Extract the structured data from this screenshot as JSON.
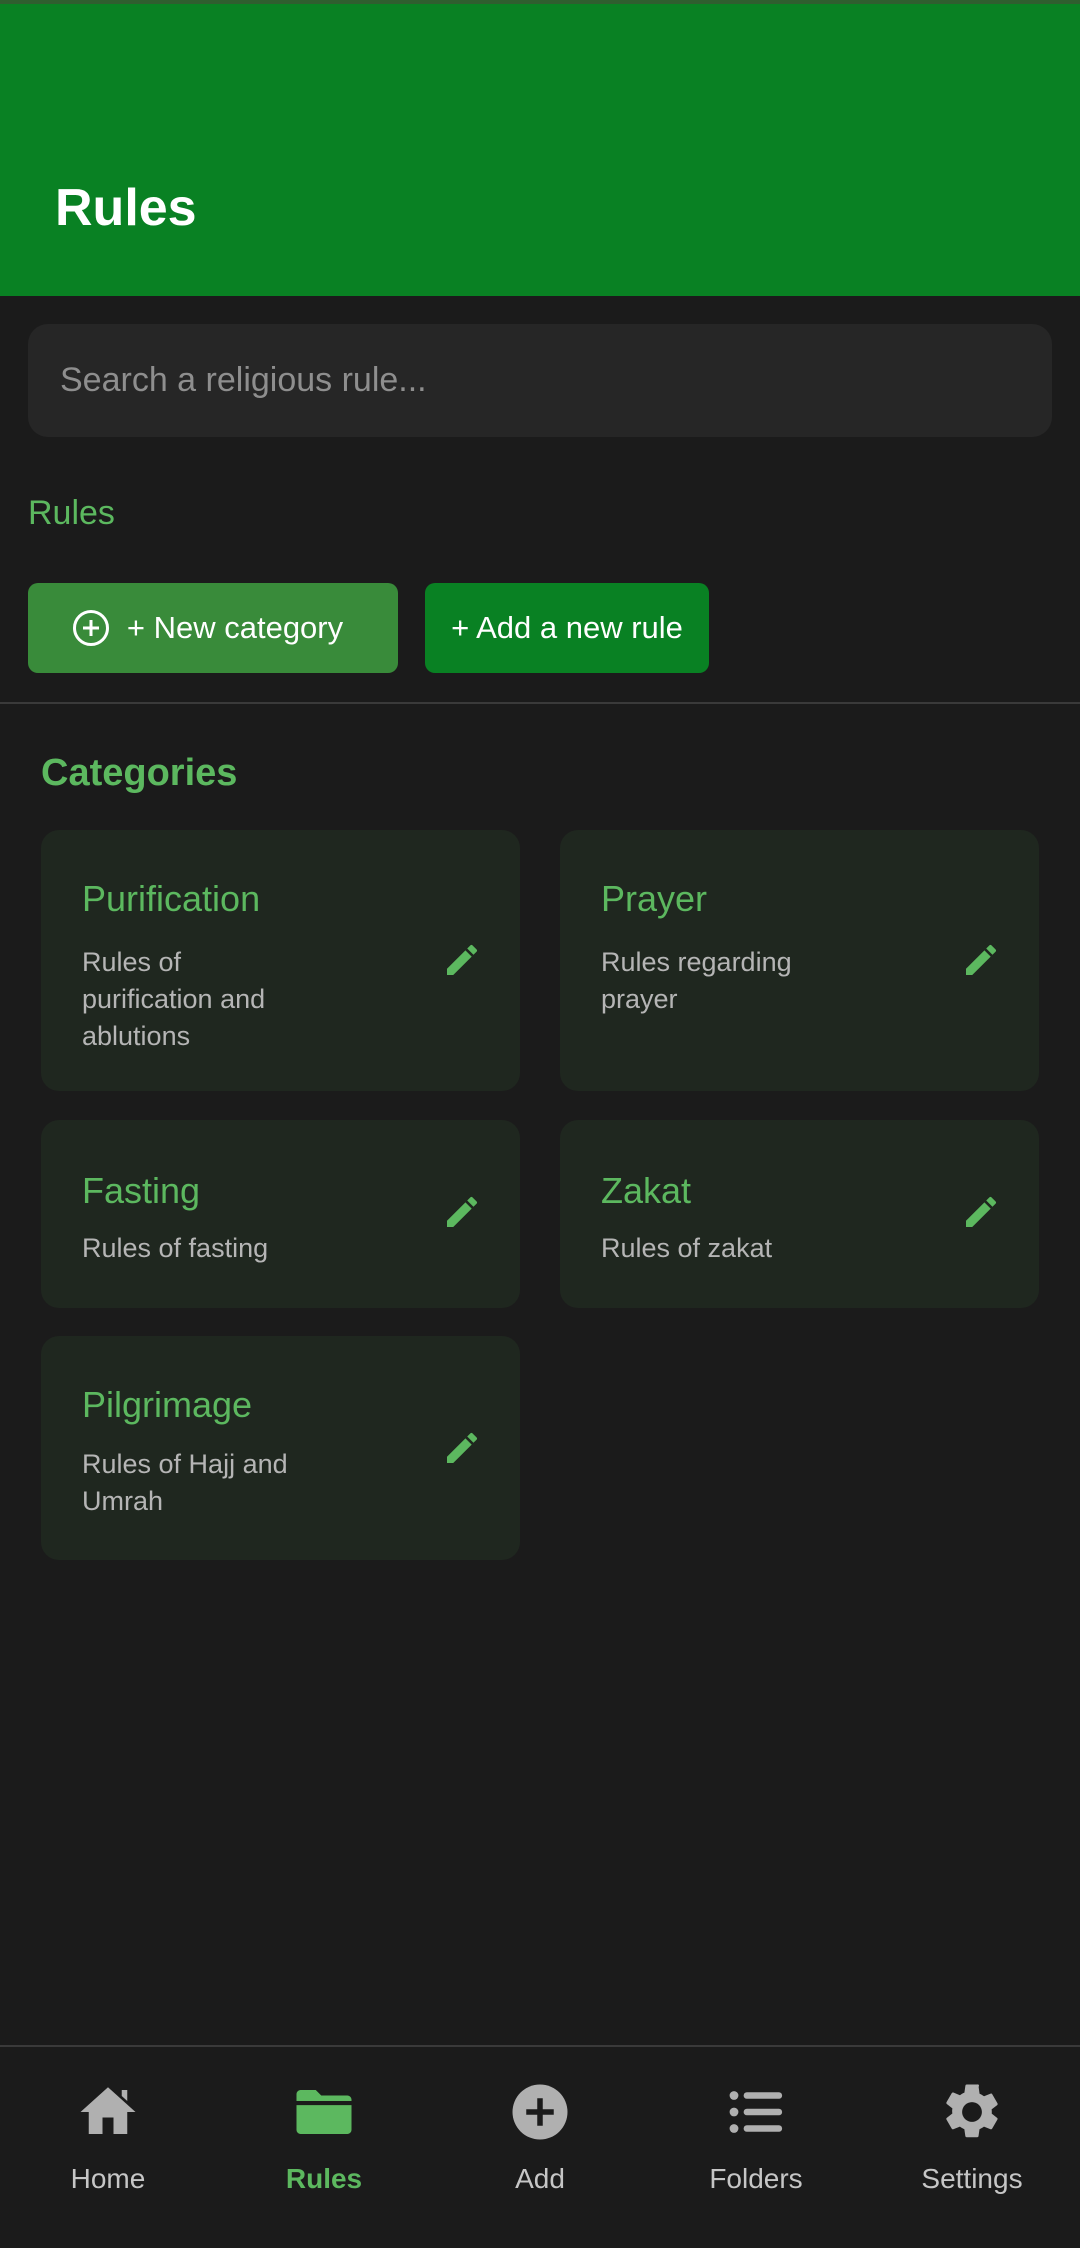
{
  "header": {
    "title": "Rules"
  },
  "search": {
    "placeholder": "Search a religious rule..."
  },
  "breadcrumb": "Rules",
  "actions": {
    "new_category": "+ New category",
    "add_rule": "+ Add a new rule"
  },
  "categories_title": "Categories",
  "categories": [
    {
      "title": "Purification",
      "desc": "Rules of purification and ablutions"
    },
    {
      "title": "Prayer",
      "desc": "Rules regarding prayer"
    },
    {
      "title": "Fasting",
      "desc": "Rules of fasting"
    },
    {
      "title": "Zakat",
      "desc": "Rules of zakat"
    },
    {
      "title": "Pilgrimage",
      "desc": "Rules of Hajj and Umrah"
    }
  ],
  "nav": [
    {
      "label": "Home",
      "icon": "home-icon",
      "active": false
    },
    {
      "label": "Rules",
      "icon": "folder-icon",
      "active": true
    },
    {
      "label": "Add",
      "icon": "add-circle-icon",
      "active": false
    },
    {
      "label": "Folders",
      "icon": "list-icon",
      "active": false
    },
    {
      "label": "Settings",
      "icon": "gear-icon",
      "active": false
    }
  ],
  "colors": {
    "primary": "#098123",
    "accent": "#5cb85f",
    "background": "#1b1b1b",
    "card": "#1f271f"
  }
}
